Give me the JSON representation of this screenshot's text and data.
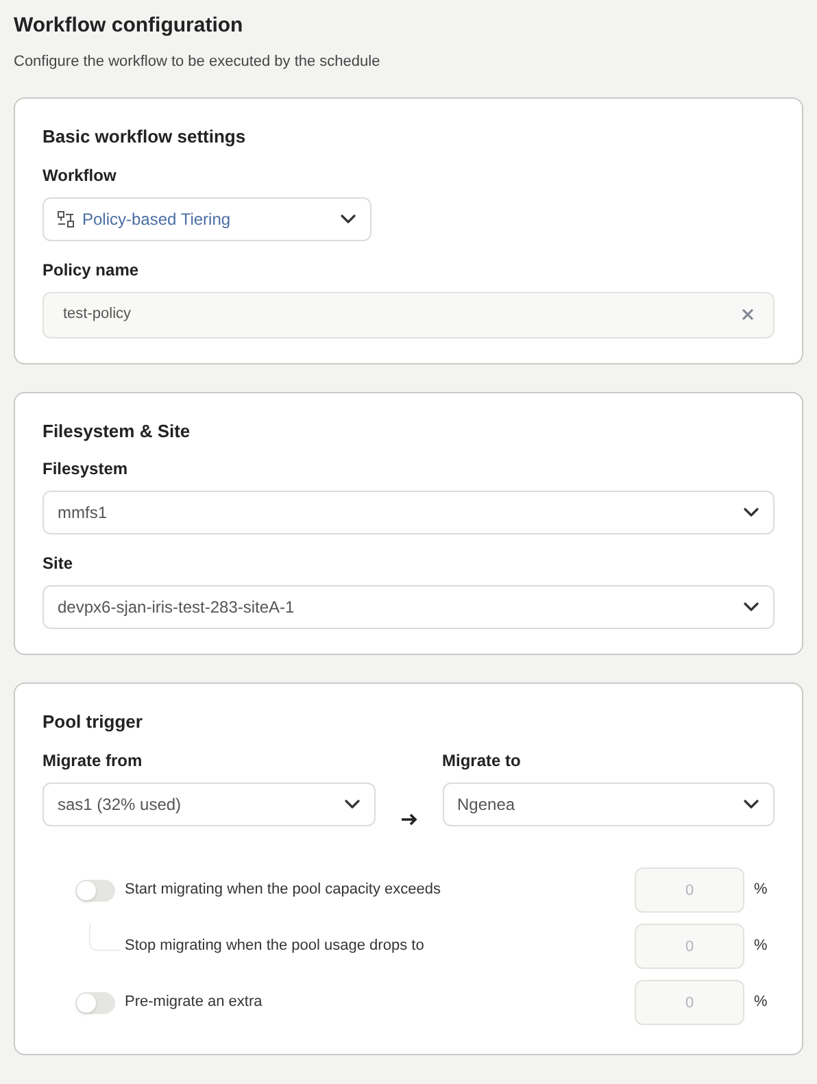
{
  "header": {
    "title": "Workflow configuration",
    "subtitle": "Configure the workflow to be executed by the schedule"
  },
  "basic": {
    "title": "Basic workflow settings",
    "workflow": {
      "label": "Workflow",
      "value": "Policy-based Tiering"
    },
    "policy_name": {
      "label": "Policy name",
      "value": "test-policy"
    }
  },
  "filesystem_site": {
    "title": "Filesystem & Site",
    "selects": [
      {
        "label": "Filesystem",
        "value": "mmfs1"
      },
      {
        "label": "Site",
        "value": "devpx6-sjan-iris-test-283-siteA-1"
      }
    ]
  },
  "pool_trigger": {
    "title": "Pool trigger",
    "migrate_from": {
      "label": "Migrate from",
      "value": "sas1 (32% used)"
    },
    "migrate_to": {
      "label": "Migrate to",
      "value": "Ngenea"
    },
    "rows": [
      {
        "kind": "toggle",
        "label": "Start migrating when the pool capacity exceeds",
        "on": false,
        "placeholder": "0",
        "unit": "%"
      },
      {
        "kind": "nested",
        "label": "Stop migrating when the pool usage drops to",
        "placeholder": "0",
        "unit": "%"
      },
      {
        "kind": "toggle",
        "label": "Pre-migrate an extra",
        "on": false,
        "placeholder": "0",
        "unit": "%"
      }
    ]
  }
}
